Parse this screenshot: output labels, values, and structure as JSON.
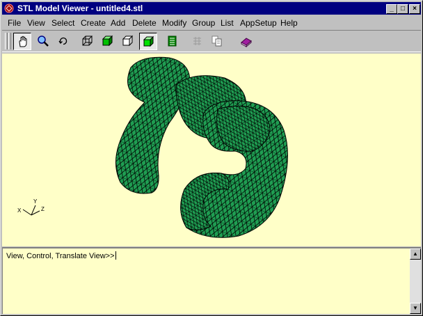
{
  "window": {
    "title": "STL Model Viewer - untitled4.stl",
    "controls": {
      "minimize": "_",
      "maximize": "□",
      "close": "×"
    }
  },
  "menu": {
    "items": [
      "File",
      "View",
      "Select",
      "Create",
      "Add",
      "Delete",
      "Modify",
      "Group",
      "List",
      "AppSetup",
      "Help"
    ]
  },
  "toolbar": {
    "buttons": [
      {
        "icon": "hand-icon",
        "pressed": true
      },
      {
        "icon": "zoom-icon",
        "pressed": false
      },
      {
        "icon": "rotate-icon",
        "pressed": false
      },
      {
        "icon": "wireframe-cube-icon",
        "pressed": false
      },
      {
        "icon": "green-cube-icon",
        "pressed": false
      },
      {
        "icon": "outline-cube-icon",
        "pressed": false
      },
      {
        "icon": "shaded-cube-icon",
        "pressed": true
      },
      {
        "icon": "list-icon",
        "pressed": false
      },
      {
        "icon": "disabled-grid-icon",
        "pressed": false
      },
      {
        "icon": "copy-icon",
        "pressed": false
      },
      {
        "icon": "book-icon",
        "pressed": false
      }
    ]
  },
  "viewport": {
    "background": "#ffffc8",
    "mesh_color": "#1f9e52",
    "axes": {
      "x": "X",
      "y": "Y",
      "z": "Z"
    }
  },
  "command": {
    "prompt": "View, Control, Translate View>>"
  }
}
